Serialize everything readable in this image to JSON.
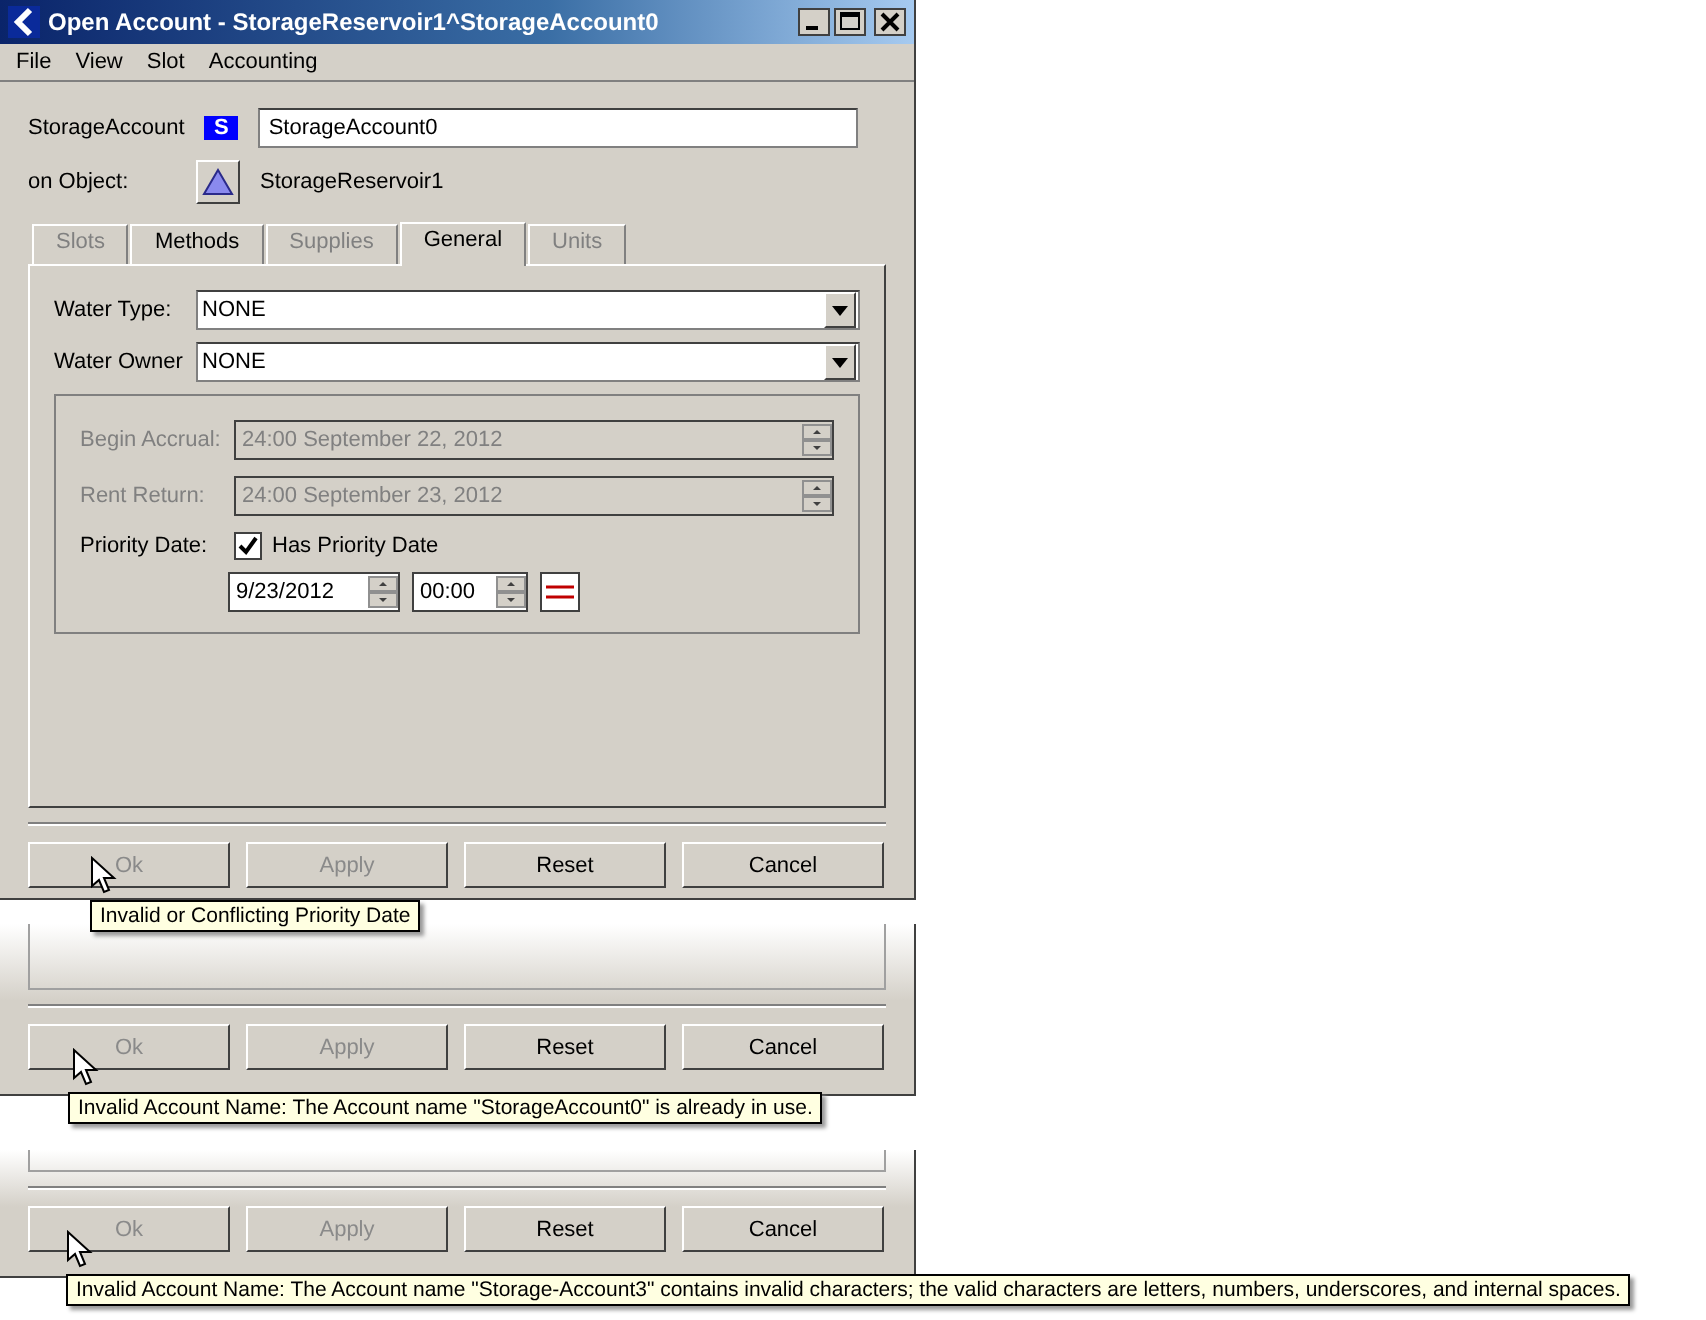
{
  "window": {
    "title": "Open Account - StorageReservoir1^StorageAccount0"
  },
  "menu": [
    "File",
    "View",
    "Slot",
    "Accounting"
  ],
  "account": {
    "label": "StorageAccount",
    "badge": "S",
    "name": "StorageAccount0"
  },
  "object": {
    "label": "on Object:",
    "name": "StorageReservoir1"
  },
  "tabs": [
    {
      "label": "Slots",
      "selected": false,
      "disabled": true
    },
    {
      "label": "Methods",
      "selected": false,
      "disabled": false
    },
    {
      "label": "Supplies",
      "selected": false,
      "disabled": true
    },
    {
      "label": "General",
      "selected": true,
      "disabled": false
    },
    {
      "label": "Units",
      "selected": false,
      "disabled": true
    }
  ],
  "dropdowns": [
    {
      "label": "Water Type:",
      "value": "NONE"
    },
    {
      "label": "Water Owner",
      "value": "NONE"
    }
  ],
  "date_fields": [
    {
      "label": "Begin Accrual:",
      "value": "24:00 September 22, 2012",
      "disabled": true
    },
    {
      "label": "Rent Return:",
      "value": "24:00 September 23, 2012",
      "disabled": true
    }
  ],
  "priority": {
    "label": "Priority Date:",
    "checkbox_label": "Has Priority Date",
    "checked": true,
    "date": "9/23/2012",
    "time": "00:00"
  },
  "panels": [
    {
      "buttons": [
        {
          "label": "Ok",
          "disabled": true
        },
        {
          "label": "Apply",
          "disabled": true
        },
        {
          "label": "Reset",
          "disabled": false
        },
        {
          "label": "Cancel",
          "disabled": false
        }
      ],
      "tooltip": "Invalid or Conflicting Priority Date"
    },
    {
      "buttons": [
        {
          "label": "Ok",
          "disabled": true
        },
        {
          "label": "Apply",
          "disabled": true
        },
        {
          "label": "Reset",
          "disabled": false
        },
        {
          "label": "Cancel",
          "disabled": false
        }
      ],
      "tooltip": "Invalid Account Name: The Account name \"StorageAccount0\" is already in use."
    },
    {
      "buttons": [
        {
          "label": "Ok",
          "disabled": true
        },
        {
          "label": "Apply",
          "disabled": true
        },
        {
          "label": "Reset",
          "disabled": false
        },
        {
          "label": "Cancel",
          "disabled": false
        }
      ],
      "tooltip": "Invalid Account Name: The Account name \"Storage-Account3\" contains invalid characters; the valid characters are letters, numbers, underscores, and internal spaces."
    }
  ]
}
